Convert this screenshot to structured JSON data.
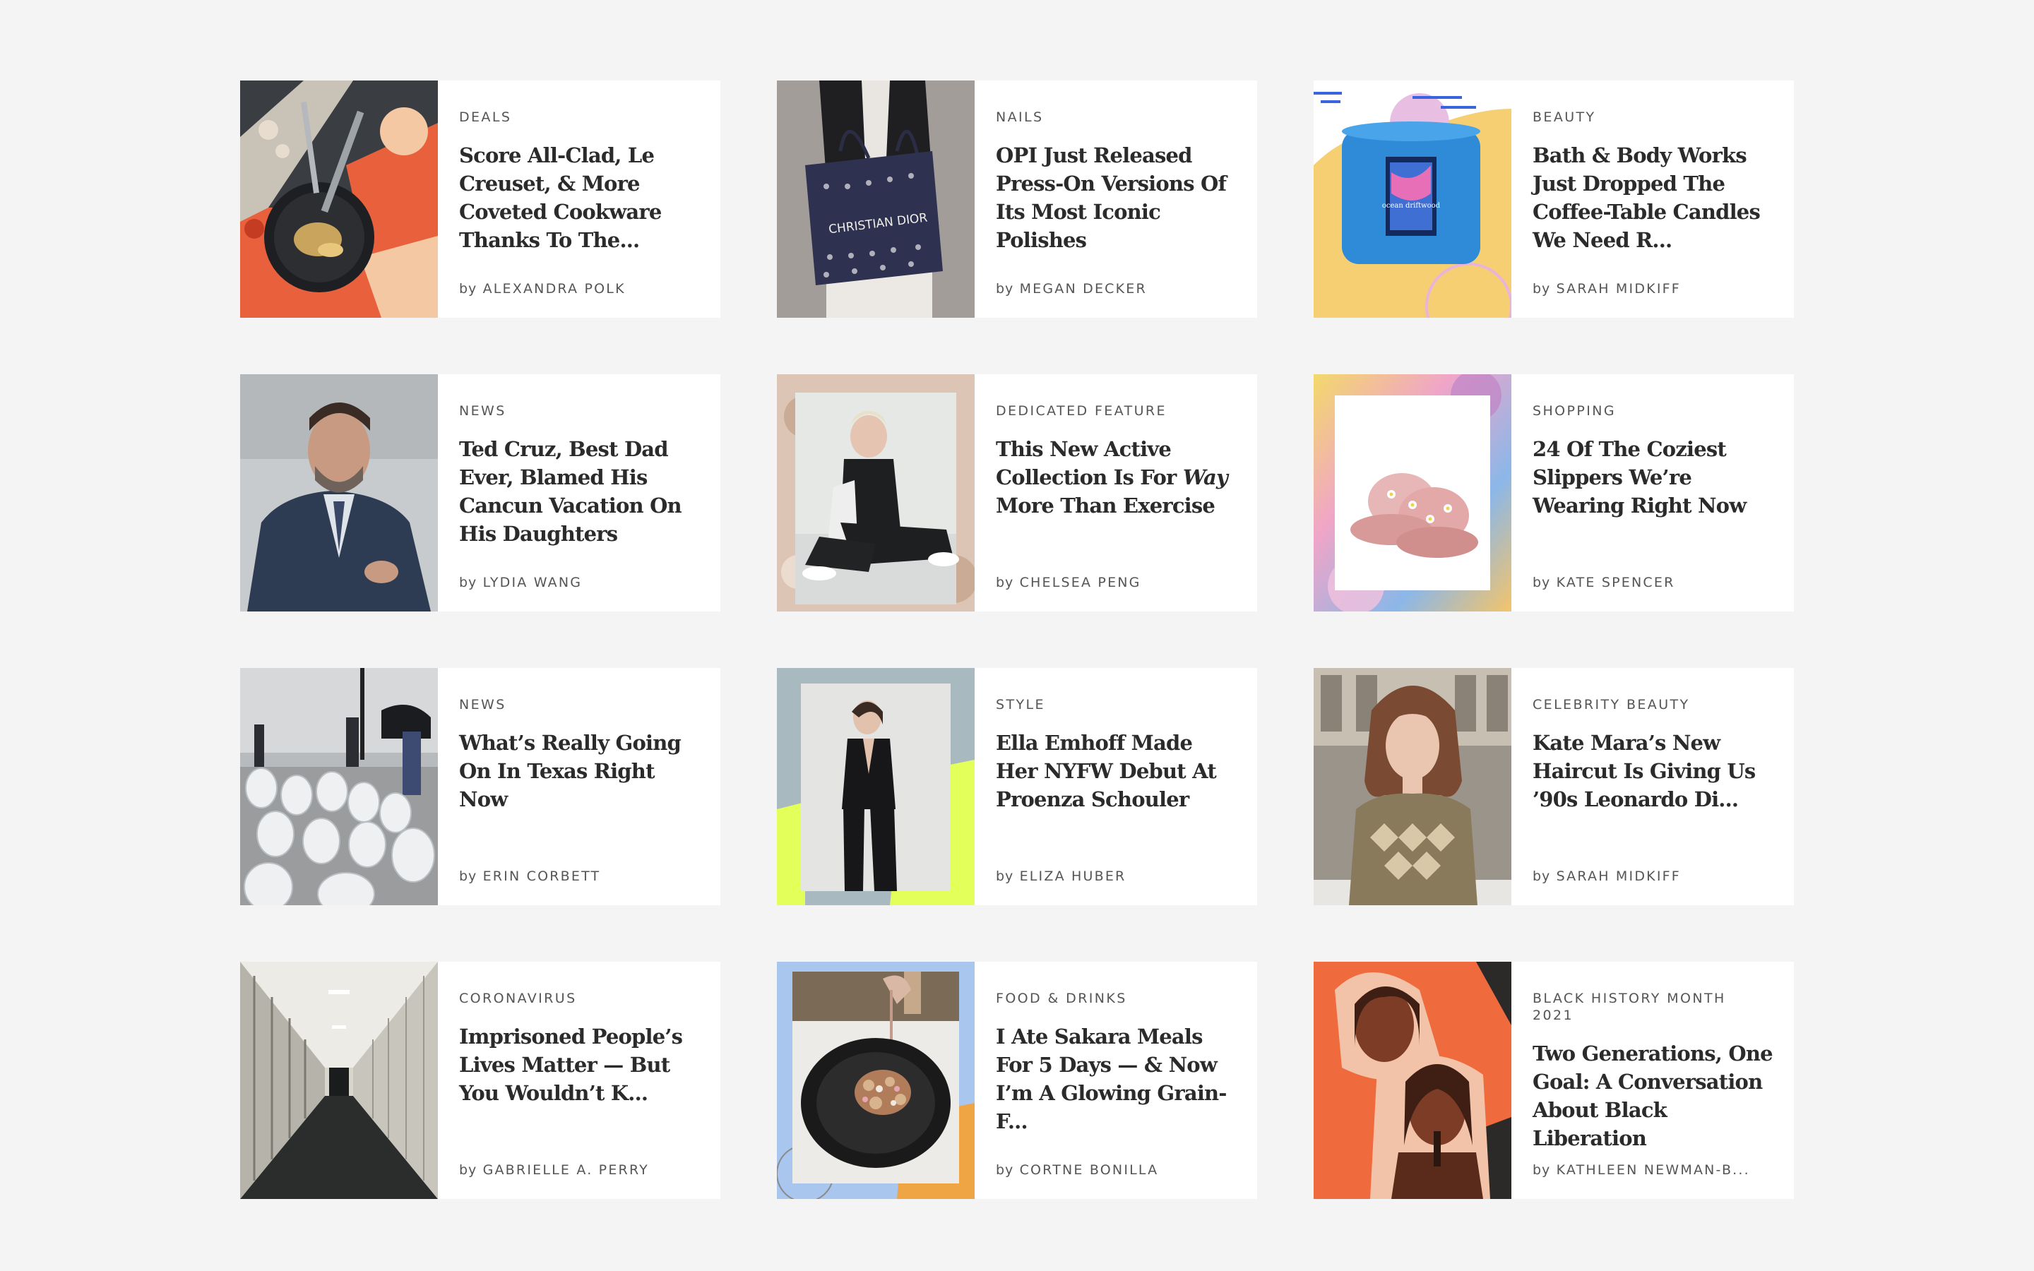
{
  "cards": [
    {
      "category": "DEALS",
      "title": "Score All-Clad, Le Creuset, & More Coveted Cookware Thanks To The...",
      "by": "by",
      "author": "ALEXANDRA POLK",
      "image": "cookware-image"
    },
    {
      "category": "NAILS",
      "title": "OPI Just Released Press-On Versions Of Its Most Iconic Polishes",
      "by": "by",
      "author": "MEGAN DECKER",
      "image": "christian-dior-tote-image",
      "image_text": "CHRISTIAN DIOR"
    },
    {
      "category": "BEAUTY",
      "title": "Bath & Body Works Just Dropped The Coffee-Table Candles We Need R...",
      "by": "by",
      "author": "SARAH MIDKIFF",
      "image": "candle-image",
      "image_text": "ocean driftwood"
    },
    {
      "category": "NEWS",
      "title": "Ted Cruz, Best Dad Ever, Blamed His Cancun Vacation On His Daughters",
      "by": "by",
      "author": "LYDIA WANG",
      "image": "politician-portrait-image"
    },
    {
      "category": "DEDICATED FEATURE",
      "title_parts": [
        "This New Active Collection Is For ",
        "Way",
        " More Than Exercise"
      ],
      "by": "by",
      "author": "CHELSEA PENG",
      "image": "activewear-model-image"
    },
    {
      "category": "SHOPPING",
      "title": "24 Of The Coziest Slippers We’re Wearing Right Now",
      "by": "by",
      "author": "KATE SPENCER",
      "image": "slippers-image"
    },
    {
      "category": "NEWS",
      "title": "What’s Really Going On In Texas Right Now",
      "by": "by",
      "author": "ERIN CORBETT",
      "image": "propane-tanks-image"
    },
    {
      "category": "STYLE",
      "title": "Ella Emhoff Made Her NYFW Debut At Proenza Schouler",
      "by": "by",
      "author": "ELIZA HUBER",
      "image": "runway-model-image"
    },
    {
      "category": "CELEBRITY BEAUTY",
      "title": "Kate Mara’s New Haircut Is Giving Us ’90s Leonardo Di...",
      "by": "by",
      "author": "SARAH MIDKIFF",
      "image": "celebrity-haircut-image"
    },
    {
      "category": "CORONAVIRUS",
      "title": "Imprisoned People’s Lives Matter — But You Wouldn’t K...",
      "by": "by",
      "author": "GABRIELLE A. PERRY",
      "image": "prison-corridor-image"
    },
    {
      "category": "FOOD & DRINKS",
      "title": "I Ate Sakara Meals For 5 Days — & Now I’m A Glowing Grain-F...",
      "by": "by",
      "author": "CORTNE BONILLA",
      "image": "granola-bowl-image"
    },
    {
      "category": "BLACK HISTORY MONTH 2021",
      "title": "Two Generations, One Goal: A Conversation About Black Liberation",
      "by": "by",
      "author": "KATHLEEN NEWMAN-B...",
      "image": "activists-collage-image"
    }
  ],
  "colors": {
    "background": "#f4f4f4",
    "card": "#ffffff",
    "title": "#2b2b2b",
    "meta": "#555555"
  }
}
